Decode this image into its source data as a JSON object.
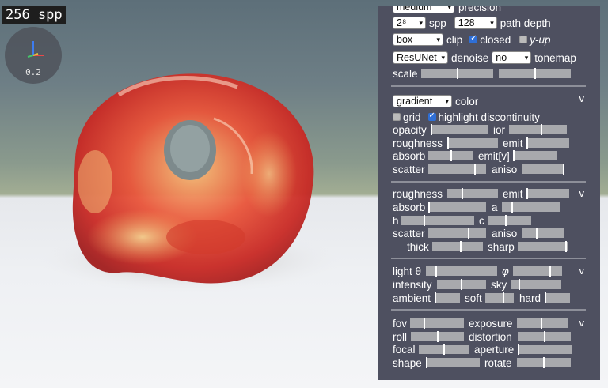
{
  "overlay": {
    "spp_counter": "256 spp",
    "axis_gizmo_value": "0.2"
  },
  "panel": {
    "top": {
      "precision_select": "medium",
      "precision_label": "precision",
      "spp_select": "2⁸",
      "spp_label": "spp",
      "depth_select": "128",
      "depth_label": "path depth",
      "clip_select": "box",
      "clip_label": "clip",
      "closed_label": "closed",
      "closed_checked": true,
      "yup_label": "y-up",
      "yup_checked": false,
      "denoise_select": "ResUNet",
      "denoise_label": "denoise",
      "tonemap_select": "no",
      "tonemap_label": "tonemap",
      "scale_label": "scale"
    },
    "material": {
      "color_select": "gradient",
      "color_label": "color",
      "collapse": "v",
      "grid_label": "grid",
      "grid_checked": false,
      "highlight_label": "highlight discontinuity",
      "highlight_checked": true,
      "opacity_label": "opacity",
      "ior_label": "ior",
      "roughness_label": "roughness",
      "emit_label": "emit",
      "absorb_label": "absorb",
      "emitv_label": "emit[v]",
      "scatter_label": "scatter",
      "aniso_label": "aniso"
    },
    "ground": {
      "roughness_label": "roughness",
      "emit_label": "emit",
      "collapse": "v",
      "absorb_label": "absorb",
      "a_label": "a",
      "h_label": "h",
      "c_label": "c",
      "scatter_label": "scatter",
      "aniso_label": "aniso",
      "thick_label": "thick",
      "sharp_label": "sharp"
    },
    "light": {
      "theta_label": "light θ",
      "phi_label": "φ",
      "collapse": "v",
      "intensity_label": "intensity",
      "sky_label": "sky",
      "ambient_label": "ambient",
      "soft_label": "soft",
      "hard_label": "hard"
    },
    "camera": {
      "fov_label": "fov",
      "exposure_label": "exposure",
      "collapse": "v",
      "roll_label": "roll",
      "distortion_label": "distortion",
      "focal_label": "focal",
      "aperture_label": "aperture",
      "shape_label": "shape",
      "rotate_label": "rotate"
    }
  }
}
